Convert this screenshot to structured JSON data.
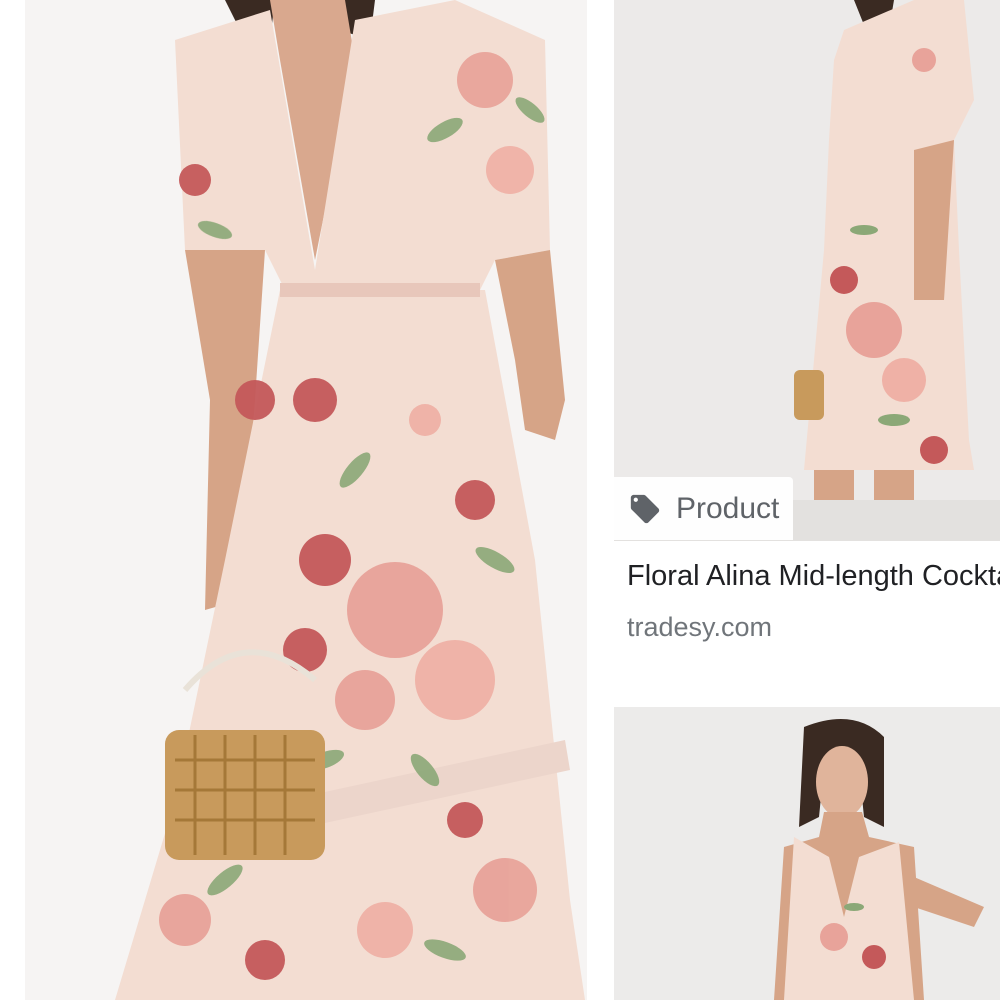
{
  "results": [
    {
      "badge": {
        "icon": "tag-icon",
        "label": "Product"
      },
      "title": "Floral Alina Mid-length Cocktail Dress",
      "source": "tradesy.com"
    }
  ],
  "colors": {
    "badge_text": "#5f6368",
    "title_text": "#202124",
    "source_text": "#70757a",
    "dress_base": "#f3ddd2",
    "flower_pink": "#e8a39a",
    "flower_red": "#c4595a",
    "leaf_green": "#8ba877"
  }
}
